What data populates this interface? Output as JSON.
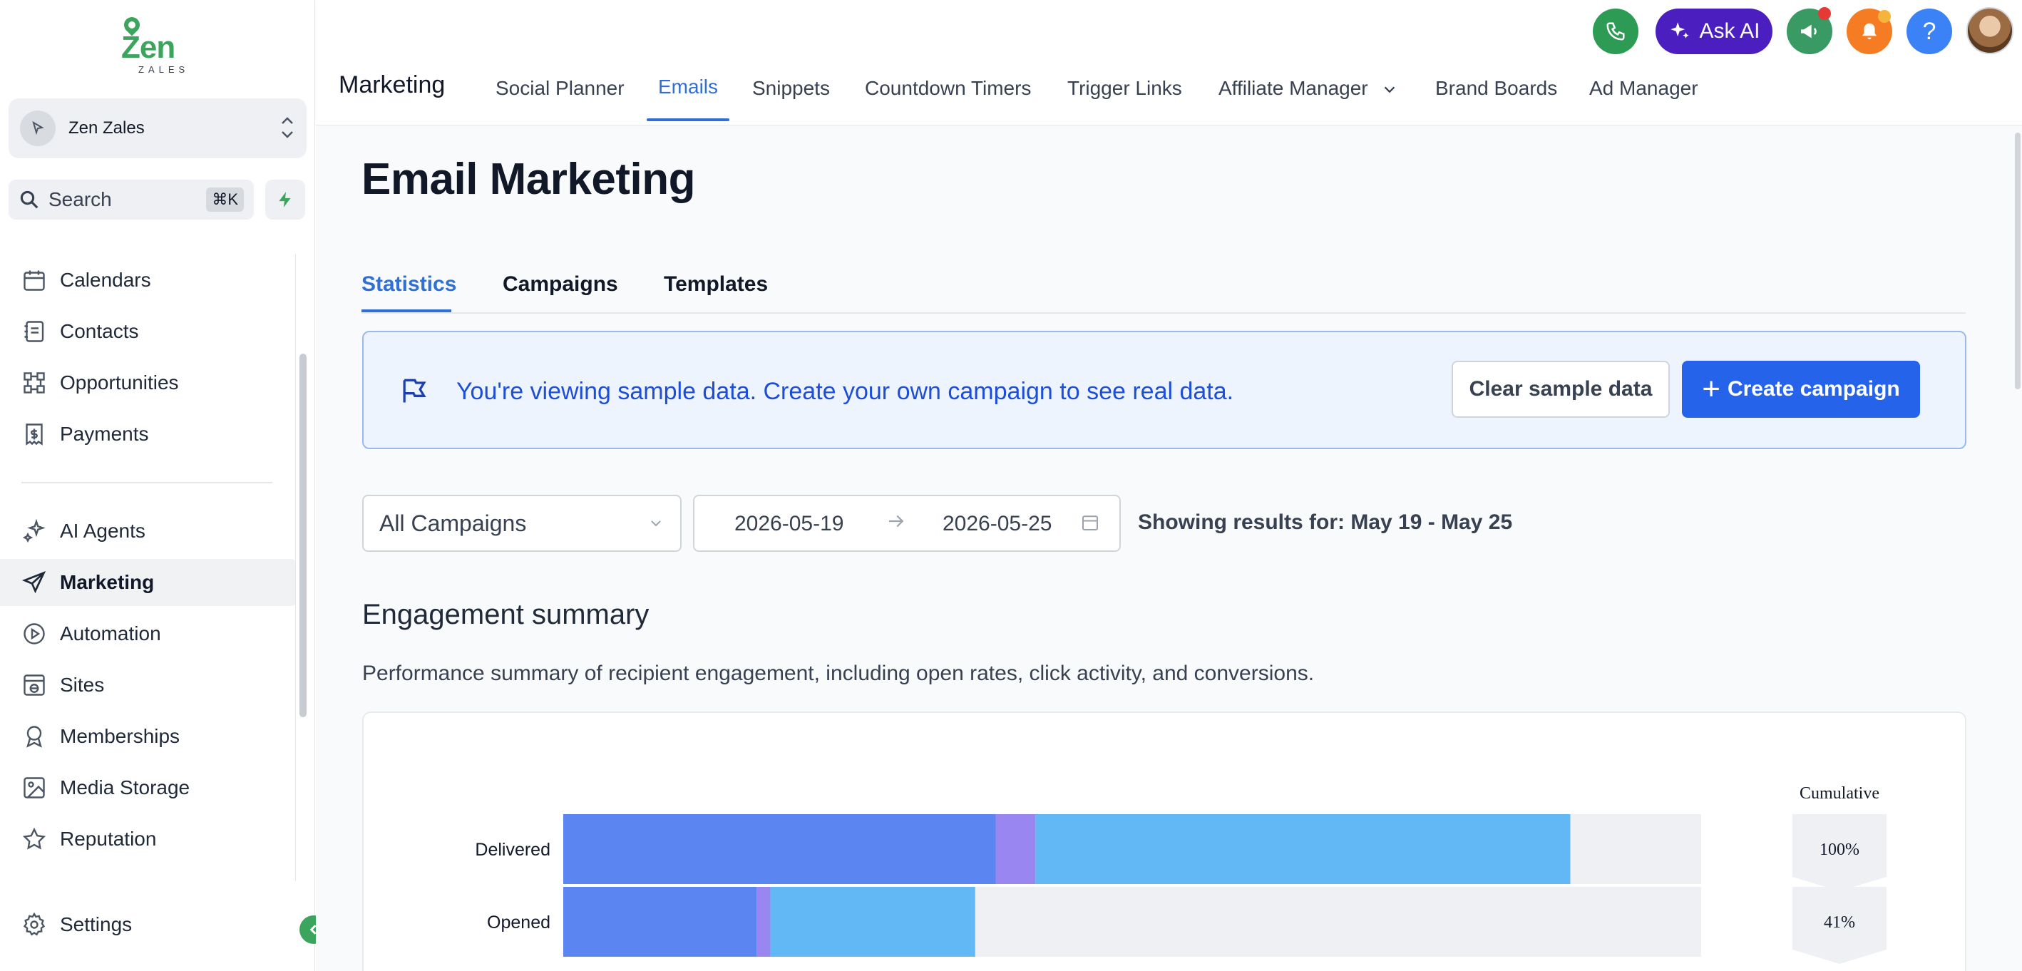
{
  "sidebar": {
    "logo_text": "Zen",
    "logo_subtext": "ZALES",
    "account_name": "Zen Zales",
    "search_placeholder": "Search",
    "search_shortcut": "⌘K",
    "items": [
      {
        "label": "Calendars",
        "icon": "calendar-icon"
      },
      {
        "label": "Contacts",
        "icon": "contacts-icon"
      },
      {
        "label": "Opportunities",
        "icon": "opportunities-icon"
      },
      {
        "label": "Payments",
        "icon": "payments-icon"
      },
      {
        "label": "AI Agents",
        "icon": "ai-agents-icon"
      },
      {
        "label": "Marketing",
        "icon": "send-icon"
      },
      {
        "label": "Automation",
        "icon": "automation-icon"
      },
      {
        "label": "Sites",
        "icon": "sites-icon"
      },
      {
        "label": "Memberships",
        "icon": "memberships-icon"
      },
      {
        "label": "Media Storage",
        "icon": "media-icon"
      },
      {
        "label": "Reputation",
        "icon": "star-icon"
      },
      {
        "label": "Settings",
        "icon": "gear-icon"
      }
    ],
    "active_item": "Marketing"
  },
  "header": {
    "module_title": "Marketing",
    "tabs": [
      {
        "label": "Social Planner"
      },
      {
        "label": "Emails"
      },
      {
        "label": "Snippets"
      },
      {
        "label": "Countdown Timers"
      },
      {
        "label": "Trigger Links"
      },
      {
        "label": "Affiliate Manager"
      },
      {
        "label": "Brand Boards"
      },
      {
        "label": "Ad Manager"
      }
    ],
    "active_tab": "Emails",
    "ask_ai_label": "Ask AI",
    "help_label": "?"
  },
  "main": {
    "page_title": "Email Marketing",
    "subtabs": [
      {
        "label": "Statistics"
      },
      {
        "label": "Campaigns"
      },
      {
        "label": "Templates"
      }
    ],
    "active_subtab": "Statistics",
    "banner": {
      "message": "You're viewing sample data. Create your own campaign to see real data.",
      "clear_label": "Clear sample data",
      "create_label": "Create campaign"
    },
    "filters": {
      "campaign_select": "All Campaigns",
      "date_from": "2026-05-19",
      "date_to": "2026-05-25",
      "showing_text": "Showing results for: May 19 - May 25"
    },
    "engagement": {
      "title": "Engagement summary",
      "subtitle": "Performance summary of recipient engagement, including open rates, click activity, and conversions."
    }
  },
  "chart_data": {
    "type": "bar",
    "orientation": "horizontal",
    "stacked": true,
    "categories": [
      "Delivered",
      "Opened"
    ],
    "series": [
      {
        "values": [
          38,
          17
        ],
        "color": "#5b86f2"
      },
      {
        "values": [
          3.5,
          1.2
        ],
        "color": "#9a86f0"
      },
      {
        "values": [
          47,
          18
        ],
        "color": "#62b8f5"
      }
    ],
    "cumulative_header": "Cumulative",
    "cumulative": [
      "100%",
      "41%"
    ],
    "xlim": [
      0,
      100
    ]
  },
  "colors": {
    "brand_green": "#3ba55d",
    "primary_blue": "#2563eb",
    "accent_link": "#2f6fd6",
    "ask_ai_purple": "#4b1fbf"
  }
}
